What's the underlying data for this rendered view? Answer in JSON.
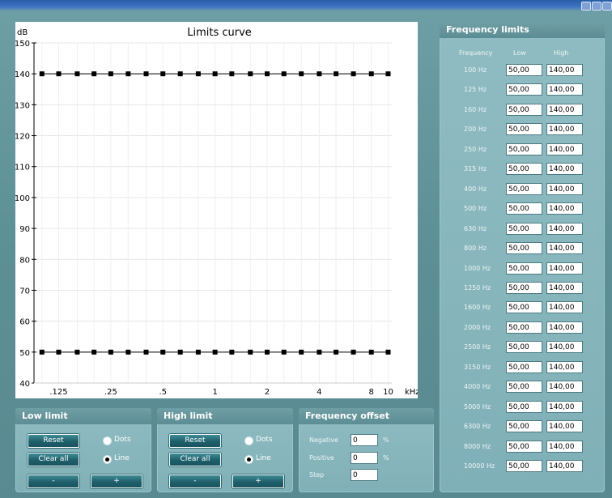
{
  "chart_data": {
    "type": "line",
    "title": "Limits curve",
    "ylabel": "dB",
    "xlabel": "kHz",
    "ylim": [
      40,
      150
    ],
    "yticks": [
      40,
      50,
      60,
      70,
      80,
      90,
      100,
      110,
      120,
      130,
      140,
      150
    ],
    "xticks": [
      ".125",
      ".25",
      ".5",
      "1",
      "2",
      "4",
      "8",
      "10"
    ],
    "x_khz": [
      0.1,
      0.125,
      0.16,
      0.2,
      0.25,
      0.315,
      0.4,
      0.5,
      0.63,
      0.8,
      1.0,
      1.25,
      1.6,
      2.0,
      2.5,
      3.15,
      4.0,
      5.0,
      6.3,
      8.0,
      10.0
    ],
    "series": [
      {
        "values": [
          140,
          140,
          140,
          140,
          140,
          140,
          140,
          140,
          140,
          140,
          140,
          140,
          140,
          140,
          140,
          140,
          140,
          140,
          140,
          140,
          140
        ],
        "color": "#000000"
      },
      {
        "values": [
          50,
          50,
          50,
          50,
          50,
          50,
          50,
          50,
          50,
          50,
          50,
          50,
          50,
          50,
          50,
          50,
          50,
          50,
          50,
          50,
          50
        ],
        "color": "#000000"
      }
    ],
    "grid": true
  },
  "low_limit": {
    "title": "Low limit",
    "reset": "Reset",
    "clear_all": "Clear all",
    "minus": "-",
    "plus": "+",
    "dots": "Dots",
    "line": "Line",
    "mode": "Line"
  },
  "high_limit": {
    "title": "High limit",
    "reset": "Reset",
    "clear_all": "Clear all",
    "minus": "-",
    "plus": "+",
    "dots": "Dots",
    "line": "Line",
    "mode": "Line"
  },
  "frequency_offset": {
    "title": "Frequency offset",
    "negative_label": "Negative",
    "negative_value": "0",
    "positive_label": "Positive",
    "positive_value": "0",
    "step_label": "Step",
    "step_value": "0",
    "unit": "%"
  },
  "frequency_limits": {
    "title": "Frequency limits",
    "col_frequency": "Frequency",
    "col_low": "Low",
    "col_high": "High",
    "rows": [
      {
        "freq": "100 Hz",
        "low": "50,00",
        "high": "140,00"
      },
      {
        "freq": "125 Hz",
        "low": "50,00",
        "high": "140,00"
      },
      {
        "freq": "160 Hz",
        "low": "50,00",
        "high": "140,00"
      },
      {
        "freq": "200 Hz",
        "low": "50,00",
        "high": "140,00"
      },
      {
        "freq": "250 Hz",
        "low": "50,00",
        "high": "140,00"
      },
      {
        "freq": "315 Hz",
        "low": "50,00",
        "high": "140,00"
      },
      {
        "freq": "400 Hz",
        "low": "50,00",
        "high": "140,00"
      },
      {
        "freq": "500 Hz",
        "low": "50,00",
        "high": "140,00"
      },
      {
        "freq": "630 Hz",
        "low": "50,00",
        "high": "140,00"
      },
      {
        "freq": "800 Hz",
        "low": "50,00",
        "high": "140,00"
      },
      {
        "freq": "1000 Hz",
        "low": "50,00",
        "high": "140,00"
      },
      {
        "freq": "1250 Hz",
        "low": "50,00",
        "high": "140,00"
      },
      {
        "freq": "1600 Hz",
        "low": "50,00",
        "high": "140,00"
      },
      {
        "freq": "2000 Hz",
        "low": "50,00",
        "high": "140,00"
      },
      {
        "freq": "2500 Hz",
        "low": "50,00",
        "high": "140,00"
      },
      {
        "freq": "3150 Hz",
        "low": "50,00",
        "high": "140,00"
      },
      {
        "freq": "4000 Hz",
        "low": "50,00",
        "high": "140,00"
      },
      {
        "freq": "5000 Hz",
        "low": "50,00",
        "high": "140,00"
      },
      {
        "freq": "6300 Hz",
        "low": "50,00",
        "high": "140,00"
      },
      {
        "freq": "8000 Hz",
        "low": "50,00",
        "high": "140,00"
      },
      {
        "freq": "10000 Hz",
        "low": "50,00",
        "high": "140,00"
      }
    ]
  }
}
